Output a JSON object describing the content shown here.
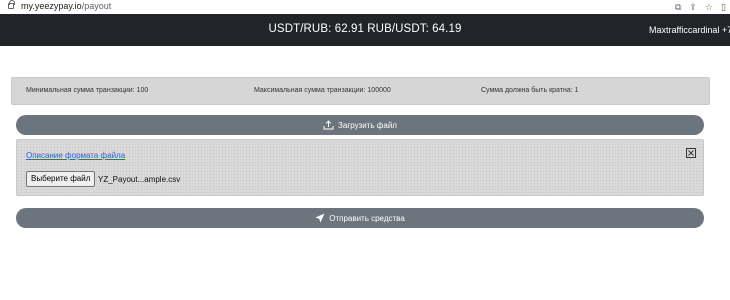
{
  "browser": {
    "url_host": "my.yeezypay.io",
    "url_path": "/payout"
  },
  "header": {
    "rates": "USDT/RUB: 62.91 RUB/USDT: 64.19",
    "account": "Maxtrafficcardinal +7"
  },
  "limits": {
    "min": "Минимальная сумма транзакции: 100",
    "max": "Максимальная сумма транзакции: 100000",
    "multiple": "Сумма должна быть кратна: 1"
  },
  "upload": {
    "button_label": "Загрузить файл",
    "format_link": "Описание формата файла",
    "choose_file_label": "Выберите файл",
    "file_name": "YZ_Payout...ample.csv"
  },
  "send": {
    "button_label": "Отправить средства"
  },
  "colors": {
    "header_bg": "#212529",
    "button_bg": "#6c757d",
    "link": "#2563eb"
  }
}
